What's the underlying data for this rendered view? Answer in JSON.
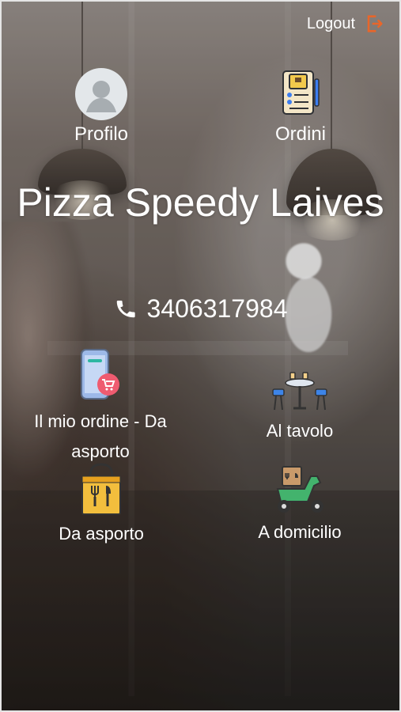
{
  "header": {
    "logout_label": "Logout",
    "logout_icon": "logout-icon",
    "accent_color": "#e8662a"
  },
  "profile": {
    "label": "Profilo",
    "icon": "avatar-icon"
  },
  "orders": {
    "label": "Ordini",
    "icon": "document-icon"
  },
  "restaurant": {
    "name": "Pizza Speedy Laives",
    "phone": "3406317984",
    "phone_icon": "phone-icon"
  },
  "menu": [
    {
      "label": "Il mio ordine - Da asporto",
      "icon": "mobile-cart-icon"
    },
    {
      "label": "Al tavolo",
      "icon": "table-icon"
    },
    {
      "label": "Da asporto",
      "icon": "takeaway-bag-icon"
    },
    {
      "label": "A domicilio",
      "icon": "delivery-scooter-icon"
    }
  ]
}
